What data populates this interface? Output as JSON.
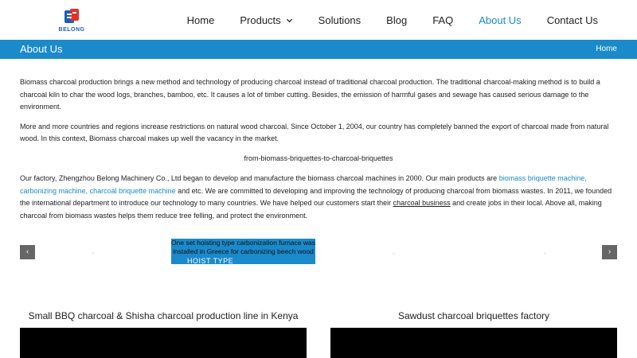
{
  "brand": {
    "logo_text": "BELONG",
    "color": "#1a5fb4"
  },
  "nav": {
    "items": [
      {
        "label": "Home"
      },
      {
        "label": "Products"
      },
      {
        "label": "Solutions"
      },
      {
        "label": "Blog"
      },
      {
        "label": "FAQ"
      },
      {
        "label": "About Us"
      },
      {
        "label": "Contact Us"
      }
    ],
    "active": "About Us"
  },
  "titlebar": {
    "title": "About Us",
    "breadcrumb": "Home",
    "color": "#1a8acb"
  },
  "content": {
    "p1": "Biomass charcoal production brings a new method and technology of producing charcoal instead of traditional charcoal production. The traditional charcoal-making method is to build a charcoal kiln to char the wood logs, branches, bamboo, etc. It causes a lot of timber cutting. Besides, the emission of harmful gases and sewage has caused serious damage to the environment.",
    "p2": "More and more countries and regions increase restrictions on natural wood charcoal. Since October 1, 2004, our country has completely banned the export of charcoal made from natural wood. In this context, Biomass charcoal makes up well the vacancy in the market.",
    "image_alt": "from-biomass-briquettes-to-charcoal-briquettes",
    "p3_a": "Our factory, Zhengzhou Belong Machinery Co., Ltd began to develop and manufacture the biomass charcoal machines in 2000. Our main products are ",
    "p3_link1": "biomass briquette machine,",
    "p3_link2": "carbonizing machine,",
    "p3_link3": "charcoal briquette machine",
    "p3_b": " and etc. We are committed to developing and improving the technology of producing charcoal from biomass wastes. In 2011, we founded the international department to introduce our technology to many countries. We have helped our customers start their ",
    "p3_link4": "charcoal business",
    "p3_c": " and create jobs in their local. Above all, making charcoal from biomass wastes helps them reduce tree felling, and protect the environment."
  },
  "slider": {
    "prev_label": "‹",
    "next_label": "›",
    "slide_caption": "One set hoisting type carbonization furnace was installed in Greece for carbonizing beech wood",
    "slide_tag": "HOIST TYPE"
  },
  "videos": [
    {
      "title": "Small BBQ charcoal & Shisha charcoal production line in Kenya"
    },
    {
      "title": "Sawdust charcoal briquettes factory"
    }
  ]
}
